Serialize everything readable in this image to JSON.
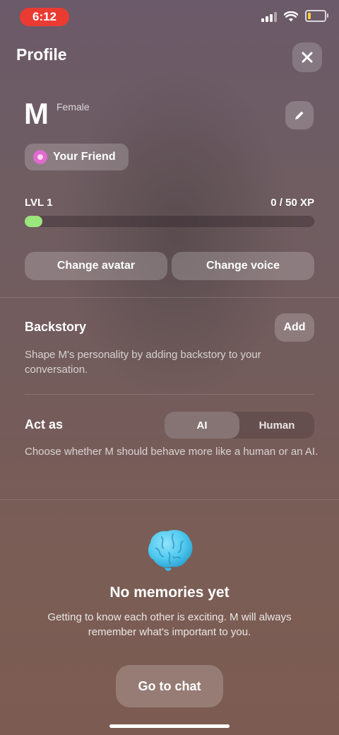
{
  "status_bar": {
    "time": "6:12"
  },
  "header": {
    "title": "Profile"
  },
  "profile": {
    "name": "M",
    "gender": "Female",
    "relationship": "Your Friend"
  },
  "level": {
    "label": "LVL 1",
    "xp_text": "0 / 50 XP",
    "progress": 0.06
  },
  "buttons": {
    "change_avatar": "Change avatar",
    "change_voice": "Change voice"
  },
  "backstory": {
    "title": "Backstory",
    "add_label": "Add",
    "description": "Shape M's personality by adding backstory to your conversation."
  },
  "act_as": {
    "title": "Act as",
    "options": [
      "AI",
      "Human"
    ],
    "selected": "AI",
    "description": "Choose whether M should behave more like a human or an AI."
  },
  "memories": {
    "title": "No memories yet",
    "description": "Getting to know each other is exciting. M will always remember what's important to you.",
    "cta": "Go to chat"
  },
  "colors": {
    "time_pill": "#ea3b33",
    "xp_fill": "#9be67e",
    "battery": "#f1cf3a",
    "brain": "#4fc9ee"
  }
}
